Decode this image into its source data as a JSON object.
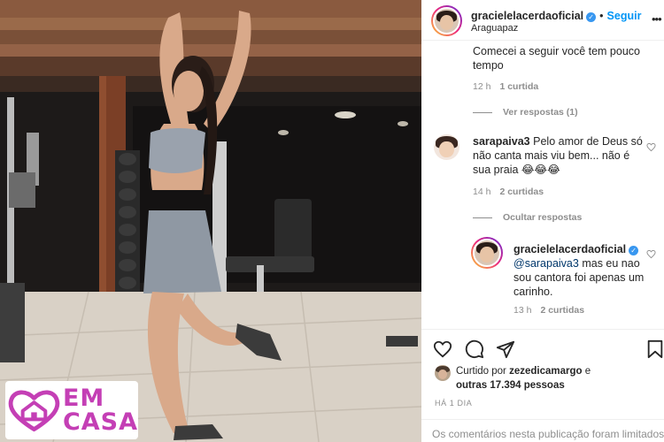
{
  "post": {
    "username": "gracielelacerdaoficial",
    "separator": "•",
    "follow_label": "Seguir",
    "location": "Araguapaz",
    "more_icon": "more-icon",
    "verified_icon": "verified-badge-icon"
  },
  "photo": {
    "badge_text_line1": "EM",
    "badge_text_line2": "CASA",
    "badge_color": "#c43fb5"
  },
  "comments": [
    {
      "text": "Comecei a seguir você tem pouco tempo",
      "age": "12 h",
      "likes": "1 curtida",
      "replies_toggle": "Ver respostas (1)"
    },
    {
      "username": "sarapaiva3",
      "text": "Pelo amor de Deus só não canta mais viu bem... não é sua praia 😂😂😂",
      "age": "14 h",
      "likes": "2 curtidas",
      "replies_toggle": "Ocultar respostas"
    },
    {
      "username": "gracielelacerdaoficial",
      "mention": "@sarapaiva3",
      "text": "mas eu nao sou cantora foi apenas um carinho.",
      "age": "13 h",
      "likes": "2 curtidas"
    }
  ],
  "actions": {
    "icons": [
      "heart-icon",
      "comment-icon",
      "share-icon",
      "bookmark-icon"
    ]
  },
  "likes": {
    "prefix": "Curtido por",
    "first_user": "zezedicamargo",
    "conjunction": "e",
    "others": "outras 17.394 pessoas"
  },
  "timestamp": "HÁ 1 DIA",
  "comments_limited_notice": "Os comentários nesta publicação foram limitados.",
  "colors": {
    "accent_blue": "#0095f6",
    "verified_blue": "#3897f0",
    "muted_text": "#8e8e8e"
  }
}
